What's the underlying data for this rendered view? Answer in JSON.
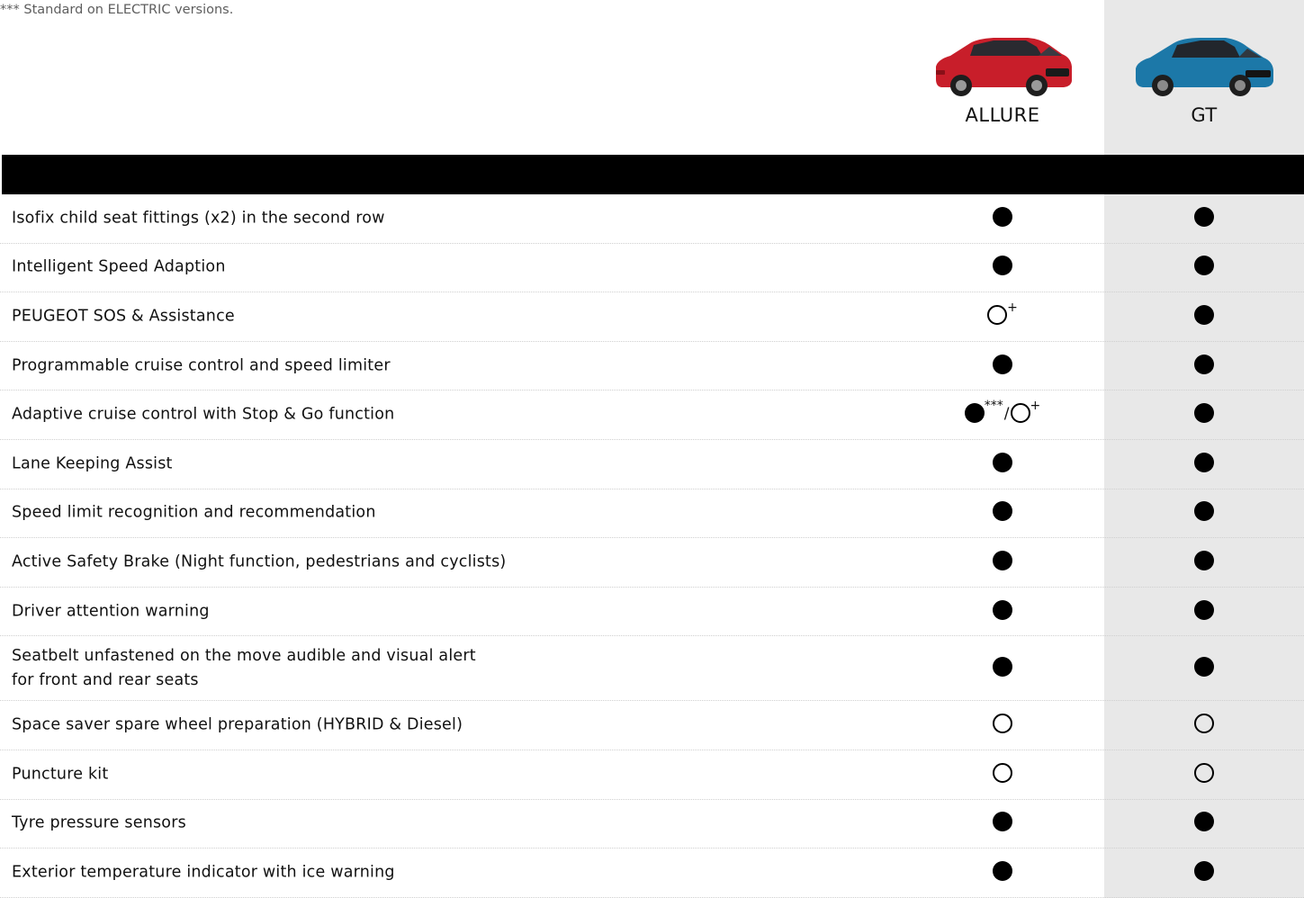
{
  "footnote": "*** Standard on ELECTRIC versions.",
  "columns": [
    {
      "name": "ALLURE",
      "car_color": "#c81e2a"
    },
    {
      "name": "GT",
      "car_color": "#1c78a8"
    }
  ],
  "symbols": {
    "plus": "+",
    "triple_star": "***",
    "slash": "/"
  },
  "rows": [
    {
      "lines": [
        "Isofix child seat fittings (x2) in the second row"
      ],
      "allure": "standard",
      "gt": "standard"
    },
    {
      "lines": [
        "Intelligent Speed Adaption"
      ],
      "allure": "standard",
      "gt": "standard"
    },
    {
      "lines": [
        "PEUGEOT SOS & Assistance"
      ],
      "allure": "option-plus",
      "gt": "standard"
    },
    {
      "lines": [
        "Programmable cruise control and speed limiter"
      ],
      "allure": "standard",
      "gt": "standard"
    },
    {
      "lines": [
        "Adaptive cruise control with Stop & Go function"
      ],
      "allure": "standard-star-or-option-plus",
      "gt": "standard"
    },
    {
      "lines": [
        "Lane Keeping Assist"
      ],
      "allure": "standard",
      "gt": "standard"
    },
    {
      "lines": [
        "Speed limit recognition and recommendation"
      ],
      "allure": "standard",
      "gt": "standard"
    },
    {
      "lines": [
        "Active Safety Brake (Night function, pedestrians and cyclists)"
      ],
      "allure": "standard",
      "gt": "standard"
    },
    {
      "lines": [
        "Driver attention warning"
      ],
      "allure": "standard",
      "gt": "standard"
    },
    {
      "lines": [
        "Seatbelt unfastened on the move audible and visual alert",
        "for front and rear seats"
      ],
      "allure": "standard",
      "gt": "standard"
    },
    {
      "lines": [
        "Space saver spare wheel preparation (HYBRID & Diesel)"
      ],
      "allure": "option",
      "gt": "option"
    },
    {
      "lines": [
        "Puncture kit"
      ],
      "allure": "option",
      "gt": "option"
    },
    {
      "lines": [
        "Tyre pressure sensors"
      ],
      "allure": "standard",
      "gt": "standard"
    },
    {
      "lines": [
        "Exterior temperature indicator with ice warning"
      ],
      "allure": "standard",
      "gt": "standard"
    }
  ]
}
